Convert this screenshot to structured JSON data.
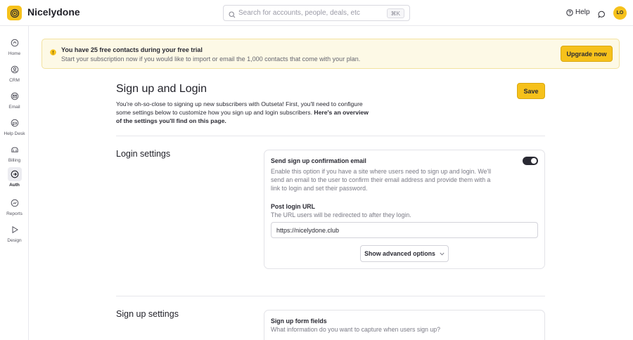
{
  "app": {
    "brand": "Nicelydone",
    "search_placeholder": "Search for accounts, people, deals, etc",
    "search_shortcut": "⌘K",
    "help_label": "Help",
    "avatar_initials": "LO",
    "accent_color": "#f6c11b"
  },
  "sidebar": {
    "items": [
      {
        "label": "Home",
        "icon": "home-icon"
      },
      {
        "label": "CRM",
        "icon": "crm-icon"
      },
      {
        "label": "Email",
        "icon": "email-icon"
      },
      {
        "label": "Help Desk",
        "icon": "help-desk-icon"
      },
      {
        "label": "Billing",
        "icon": "billing-icon"
      },
      {
        "label": "Auth",
        "icon": "auth-icon",
        "active": true
      },
      {
        "label": "Reports",
        "icon": "reports-icon"
      },
      {
        "label": "Design",
        "icon": "design-icon"
      }
    ]
  },
  "banner": {
    "title": "You have 25 free contacts during your free trial",
    "text": "Start your subscription now if you would like to import or email the 1,000 contacts that come with your plan.",
    "button": "Upgrade now"
  },
  "page": {
    "title": "Sign up and Login",
    "intro_plain": "You're oh-so-close to signing up new subscribers with Outseta! First, you'll need to configure some settings below to customize how you sign up and login subscribers. ",
    "intro_bold": "Here's an overview of the settings you'll find on this page.",
    "save_label": "Save"
  },
  "login_settings": {
    "title": "Login settings",
    "confirm_email_title": "Send sign up confirmation email",
    "confirm_email_desc": "Enable this option if you have a site where users need to sign up and login. We'll send an email to the user to confirm their email address and provide them with a link to login and set their password.",
    "confirm_email_enabled": true,
    "post_login_title": "Post login URL",
    "post_login_desc": "The URL users will be redirected to after they login.",
    "post_login_value": "https://nicelydone.club",
    "advanced_label": "Show advanced options"
  },
  "signup_settings": {
    "title": "Sign up settings",
    "form_fields_title": "Sign up form fields",
    "form_fields_desc": "What information do you want to capture when users sign up?"
  }
}
